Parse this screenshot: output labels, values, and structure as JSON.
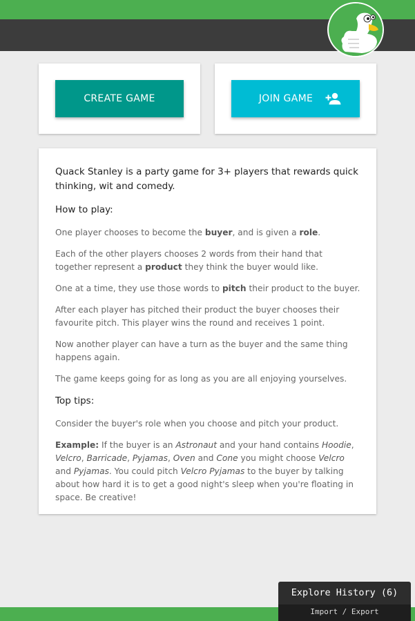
{
  "header": {
    "brand_color": "#4caf50",
    "bar_color": "#3c3c3c",
    "logo_icon": "duck-thumbs-up-icon"
  },
  "actions": {
    "create_label": "CREATE GAME",
    "create_color": "#00978a",
    "join_label": "JOIN GAME",
    "join_color": "#00bcd4",
    "join_icon": "person-add-icon"
  },
  "rules": {
    "intro": "Quack Stanley is a party game for 3+ players that rewards quick thinking, wit and comedy.",
    "how_to_play_title": "How to play:",
    "steps": {
      "s1": {
        "a": "One player chooses to become the ",
        "b1": "buyer",
        "c": ", and is given a ",
        "b2": "role",
        "d": "."
      },
      "s2": {
        "a": "Each of the other players chooses 2 words from their hand that together represent a ",
        "b1": "product",
        "c": " they think the buyer would like."
      },
      "s3": {
        "a": "One at a time, they use those words to ",
        "b1": "pitch",
        "c": " their product to the buyer."
      },
      "s4": "After each player has pitched their product the buyer chooses their favourite pitch. This player wins the round and receives 1 point.",
      "s5": "Now another player can have a turn as the buyer and the same thing happens again.",
      "s6": "The game keeps going for as long as you are all enjoying yourselves."
    },
    "tips_title": "Top tips:",
    "tip1": "Consider the buyer's role when you choose and pitch your product.",
    "example": {
      "label": "Example:",
      "t1": " If the buyer is an ",
      "astronaut": "Astronaut",
      "t2": " and your hand contains ",
      "w1": "Hoodie",
      "c1": ", ",
      "w2": "Velcro",
      "c2": ", ",
      "w3": "Barricade",
      "c3": ", ",
      "w4": "Pyjamas",
      "c4": ", ",
      "w5": "Oven",
      "and1": " and ",
      "w6": "Cone",
      "t3": " you might choose ",
      "pick1": "Velcro",
      "and2": " and ",
      "pick2": "Pyjamas",
      "t4": ". You could pitch ",
      "product": "Velcro Pyjamas",
      "t5": " to the buyer by talking about how hard it is to get a good night's sleep when you're floating in space. Be creative!"
    }
  },
  "history_panel": {
    "title": "Explore History (6)",
    "sub": "Import / Export"
  }
}
